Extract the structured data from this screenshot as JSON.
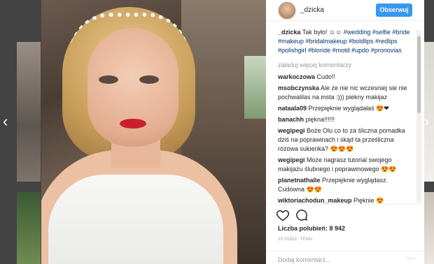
{
  "nav": {
    "prev_icon": "chevron-left-icon",
    "next_icon": "chevron-right-icon",
    "prev_glyph": "‹",
    "next_glyph": "›"
  },
  "post": {
    "username": "_dzicka",
    "follow_label": "Obserwuj",
    "caption_user": "_dzicka",
    "caption_text": "Tak było! ☺☺",
    "hashtags": [
      "#wedding",
      "#selfie",
      "#bride",
      "#makeup",
      "#bridalmakeup",
      "#boldlips",
      "#redlips",
      "#polishgirl",
      "#blonde",
      "#motd",
      "#updo",
      "#pronovias"
    ],
    "load_more": "załaduj więcej komentarzy",
    "comments": [
      {
        "user": "warkoczowa",
        "text": "Cudo!!"
      },
      {
        "user": "msobczynska",
        "text": "Ale ze nie nic wczesniej sie nie pochwalilas na insta :))) piekny makijaz"
      },
      {
        "user": "nataala09",
        "text": "Przepięknie wyglądałaś 😍❤"
      },
      {
        "user": "banachh",
        "text": "piękna!!!!!!"
      },
      {
        "user": "wegipegi",
        "text": "Boże Olu co to za śliczna pomadka dziś na poprawinach i skąd ta prześliczna różowa sukienka? 😍😍😍"
      },
      {
        "user": "wegipegi",
        "text": "Może nagrasz tutorial swojego makijażu ślubnego i poprawinowego 😍😍"
      },
      {
        "user": "planetnathalie",
        "text": "Przepięknie wyglądasz. Cudowna 😍😍"
      },
      {
        "user": "wiktoriachodun_makeup",
        "text": "Pięknie 😍"
      }
    ],
    "likes_label": "Liczba polubień:",
    "likes_count": "8 942",
    "time": "10 GODZ. TEMU",
    "comment_placeholder": "Dodaj komentarz...",
    "more_glyph": "···"
  },
  "colors": {
    "follow_button": "#3897f0",
    "hashtag": "#003569"
  }
}
